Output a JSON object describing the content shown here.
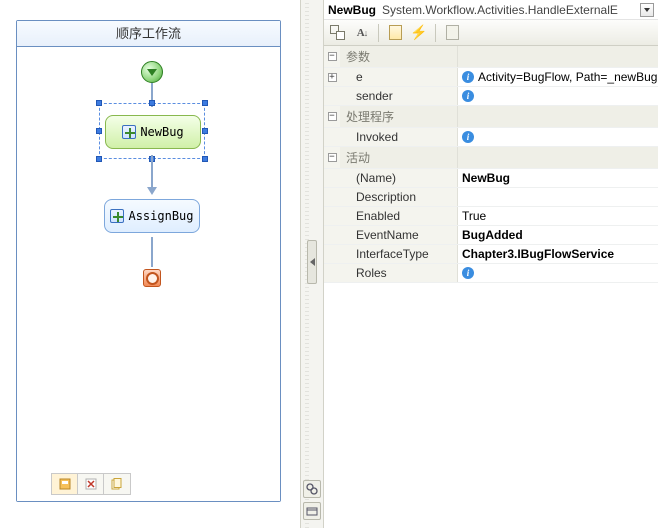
{
  "designer": {
    "workflow_title": "顺序工作流",
    "activities": {
      "newbug": "NewBug",
      "assign": "AssignBug"
    }
  },
  "propHeader": {
    "object": "NewBug",
    "type": "System.Workflow.Activities.HandleExternalE"
  },
  "categories": {
    "params": "参数",
    "handlers": "处理程序",
    "activity": "活动"
  },
  "props": {
    "e_label": "e",
    "e_value": "Activity=BugFlow, Path=_newBug",
    "sender_label": "sender",
    "invoked_label": "Invoked",
    "name_label": "(Name)",
    "name_value": "NewBug",
    "description_label": "Description",
    "enabled_label": "Enabled",
    "enabled_value": "True",
    "eventname_label": "EventName",
    "eventname_value": "BugAdded",
    "interfacetype_label": "InterfaceType",
    "interfacetype_value": "Chapter3.IBugFlowService",
    "roles_label": "Roles"
  }
}
